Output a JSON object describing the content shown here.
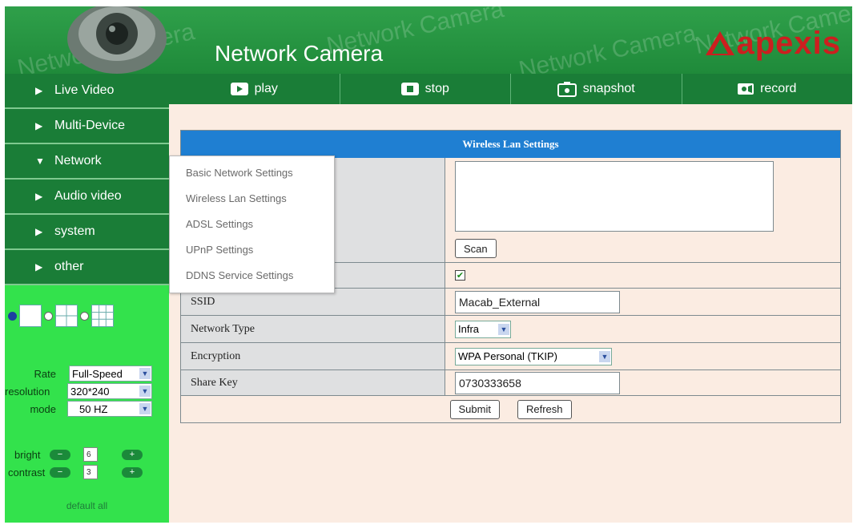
{
  "header": {
    "title": "Network Camera",
    "watermark": "Network Camera",
    "brand": "apexis",
    "brand_color": "#cc1f1f"
  },
  "toolbar": {
    "play": "play",
    "stop": "stop",
    "snapshot": "snapshot",
    "record": "record"
  },
  "sidebar": {
    "items": [
      {
        "label": "Live Video",
        "arrow": "▶"
      },
      {
        "label": "Multi-Device",
        "arrow": "▶"
      },
      {
        "label": "Network",
        "arrow": "▼"
      },
      {
        "label": "Audio video",
        "arrow": "▶"
      },
      {
        "label": "system",
        "arrow": "▶"
      },
      {
        "label": "other",
        "arrow": "▶"
      }
    ],
    "controls": {
      "rate_label": "Rate",
      "rate_value": "Full-Speed",
      "resolution_label": "resolution",
      "resolution_value": "320*240",
      "mode_label": "mode",
      "mode_value": "50 HZ",
      "bright_label": "bright",
      "bright_value": "6",
      "contrast_label": "contrast",
      "contrast_value": "3",
      "default_all": "default all"
    }
  },
  "network_menu": [
    "Basic Network Settings",
    "Wireless Lan Settings",
    "ADSL Settings",
    "UPnP Settings",
    "DDNS Service Settings"
  ],
  "form": {
    "title": "Wireless Lan Settings",
    "scan_button": "Scan",
    "ssid_label": "SSID",
    "ssid_value": "Macab_External",
    "network_type_label": "Network Type",
    "network_type_value": "Infra",
    "encryption_label": "Encryption",
    "encryption_value": "WPA Personal (TKIP)",
    "share_key_label": "Share Key",
    "share_key_value": "0730333658",
    "submit_button": "Submit",
    "refresh_button": "Refresh"
  }
}
